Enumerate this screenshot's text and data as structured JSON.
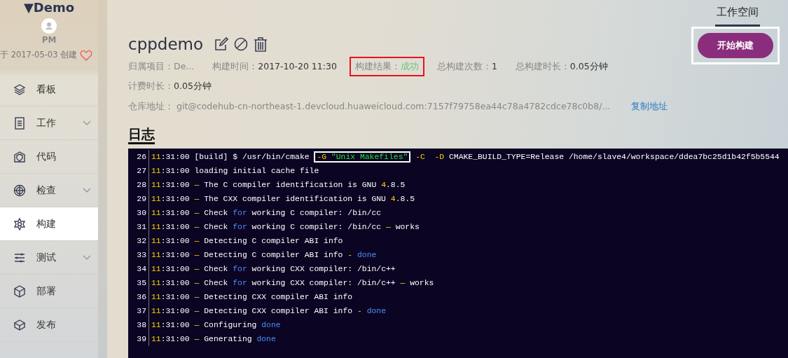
{
  "sidebar": {
    "project": "Demo",
    "collapse_marker": "▼",
    "role": "PM",
    "created": "于 2017-05-03 创建",
    "items": [
      {
        "label": "看板",
        "expandable": false,
        "selected": false
      },
      {
        "label": "工作",
        "expandable": true,
        "selected": false
      },
      {
        "label": "代码",
        "expandable": false,
        "selected": false
      },
      {
        "label": "检查",
        "expandable": true,
        "selected": false
      },
      {
        "label": "构建",
        "expandable": false,
        "selected": true
      },
      {
        "label": "测试",
        "expandable": true,
        "selected": false
      },
      {
        "label": "部署",
        "expandable": false,
        "selected": false
      },
      {
        "label": "发布",
        "expandable": false,
        "selected": false
      }
    ]
  },
  "top_tabs": [
    {
      "label": "工作空间",
      "selected": true
    }
  ],
  "job": {
    "name": "cppdemo",
    "meta_rows": [
      [
        {
          "label": "归属项目：",
          "value": "De...",
          "kind": "muted",
          "highlighted": false
        },
        {
          "label": "构建时间：",
          "value": "2017-10-20 11:30",
          "kind": "plain",
          "highlighted": false
        },
        {
          "label": "构建结果：",
          "value": "成功",
          "kind": "success",
          "highlighted": true
        },
        {
          "label": "总构建次数：",
          "value": "1",
          "kind": "plain",
          "highlighted": false
        },
        {
          "label": "总构建时长：",
          "value": "0.05分钟",
          "kind": "plain",
          "highlighted": false
        }
      ],
      [
        {
          "label": "计费时长：",
          "value": "0.05分钟",
          "kind": "plain",
          "highlighted": false
        }
      ]
    ],
    "repo": {
      "label": "仓库地址：",
      "value": "git@codehub-cn-northeast-1.devcloud.huaweicloud.com:7157f79758ea44c78a4782cdce78c0b8/...",
      "copy_link": "复制地址"
    },
    "start_button": {
      "label": "开始构建",
      "highlighted": true
    }
  },
  "log": {
    "heading": "日志",
    "lines": [
      {
        "number": "26",
        "segments": [
          {
            "text": "11",
            "kind": "hour"
          },
          {
            "text": ":31:00 [build] $ /usr/bin/cmake ",
            "kind": "plain"
          },
          {
            "kind": "group",
            "outlined": true,
            "segments": [
              {
                "text": "-G",
                "kind": "option"
              },
              {
                "text": " \"Unix Makefiles\"",
                "kind": "string"
              }
            ]
          },
          {
            "text": " -C",
            "kind": "option"
          },
          {
            "text": "  -D",
            "kind": "option"
          },
          {
            "text": " CMAKE_BUILD_TYPE=Release /home/slave4/workspace/ddea7bc25d1b42f5b5544",
            "kind": "plain"
          }
        ]
      },
      {
        "number": "27",
        "segments": [
          {
            "text": "11",
            "kind": "hour"
          },
          {
            "text": ":31:00 loading initial cache file",
            "kind": "plain"
          }
        ]
      },
      {
        "number": "28",
        "segments": [
          {
            "text": "11",
            "kind": "hour"
          },
          {
            "text": ":31:00 ",
            "kind": "plain"
          },
          {
            "text": "—",
            "kind": "option"
          },
          {
            "text": " The C compiler identification is GNU ",
            "kind": "plain"
          },
          {
            "text": "4",
            "kind": "number"
          },
          {
            "text": ".8.5",
            "kind": "plain"
          }
        ]
      },
      {
        "number": "29",
        "segments": [
          {
            "text": "11",
            "kind": "hour"
          },
          {
            "text": ":31:00 ",
            "kind": "plain"
          },
          {
            "text": "—",
            "kind": "option"
          },
          {
            "text": " The CXX compiler identification is GNU ",
            "kind": "plain"
          },
          {
            "text": "4",
            "kind": "number"
          },
          {
            "text": ".8.5",
            "kind": "plain"
          }
        ]
      },
      {
        "number": "30",
        "segments": [
          {
            "text": "11",
            "kind": "hour"
          },
          {
            "text": ":31:00 ",
            "kind": "plain"
          },
          {
            "text": "—",
            "kind": "option"
          },
          {
            "text": " Check ",
            "kind": "plain"
          },
          {
            "text": "for",
            "kind": "keyword"
          },
          {
            "text": " working C compiler: /bin/cc",
            "kind": "plain"
          }
        ]
      },
      {
        "number": "31",
        "segments": [
          {
            "text": "11",
            "kind": "hour"
          },
          {
            "text": ":31:00 ",
            "kind": "plain"
          },
          {
            "text": "—",
            "kind": "option"
          },
          {
            "text": " Check ",
            "kind": "plain"
          },
          {
            "text": "for",
            "kind": "keyword"
          },
          {
            "text": " working C compiler: /bin/cc ",
            "kind": "plain"
          },
          {
            "text": "—",
            "kind": "option"
          },
          {
            "text": " works",
            "kind": "plain"
          }
        ]
      },
      {
        "number": "32",
        "segments": [
          {
            "text": "11",
            "kind": "hour"
          },
          {
            "text": ":31:00 ",
            "kind": "plain"
          },
          {
            "text": "—",
            "kind": "option"
          },
          {
            "text": " Detecting C compiler ABI info",
            "kind": "plain"
          }
        ]
      },
      {
        "number": "33",
        "segments": [
          {
            "text": "11",
            "kind": "hour"
          },
          {
            "text": ":31:00 ",
            "kind": "plain"
          },
          {
            "text": "—",
            "kind": "option"
          },
          {
            "text": " Detecting C compiler ABI info ",
            "kind": "plain"
          },
          {
            "text": "-",
            "kind": "option"
          },
          {
            "text": " done",
            "kind": "keyword"
          }
        ]
      },
      {
        "number": "34",
        "segments": [
          {
            "text": "11",
            "kind": "hour"
          },
          {
            "text": ":31:00 ",
            "kind": "plain"
          },
          {
            "text": "—",
            "kind": "option"
          },
          {
            "text": " Check ",
            "kind": "plain"
          },
          {
            "text": "for",
            "kind": "keyword"
          },
          {
            "text": " working CXX compiler: /bin/c++",
            "kind": "plain"
          }
        ]
      },
      {
        "number": "35",
        "segments": [
          {
            "text": "11",
            "kind": "hour"
          },
          {
            "text": ":31:00 ",
            "kind": "plain"
          },
          {
            "text": "—",
            "kind": "option"
          },
          {
            "text": " Check ",
            "kind": "plain"
          },
          {
            "text": "for",
            "kind": "keyword"
          },
          {
            "text": " working CXX compiler: /bin/c++ ",
            "kind": "plain"
          },
          {
            "text": "—",
            "kind": "option"
          },
          {
            "text": " works",
            "kind": "plain"
          }
        ]
      },
      {
        "number": "36",
        "segments": [
          {
            "text": "11",
            "kind": "hour"
          },
          {
            "text": ":31:00 ",
            "kind": "plain"
          },
          {
            "text": "—",
            "kind": "option"
          },
          {
            "text": " Detecting CXX compiler ABI info",
            "kind": "plain"
          }
        ]
      },
      {
        "number": "37",
        "segments": [
          {
            "text": "11",
            "kind": "hour"
          },
          {
            "text": ":31:00 ",
            "kind": "plain"
          },
          {
            "text": "—",
            "kind": "option"
          },
          {
            "text": " Detecting CXX compiler ABI info ",
            "kind": "plain"
          },
          {
            "text": "-",
            "kind": "option"
          },
          {
            "text": " done",
            "kind": "keyword"
          }
        ]
      },
      {
        "number": "38",
        "segments": [
          {
            "text": "11",
            "kind": "hour"
          },
          {
            "text": ":31:00 ",
            "kind": "plain"
          },
          {
            "text": "—",
            "kind": "option"
          },
          {
            "text": " Configuring ",
            "kind": "plain"
          },
          {
            "text": "done",
            "kind": "keyword"
          }
        ]
      },
      {
        "number": "39",
        "segments": [
          {
            "text": "11",
            "kind": "hour"
          },
          {
            "text": ":31:00 ",
            "kind": "plain"
          },
          {
            "text": "—",
            "kind": "option"
          },
          {
            "text": " Generating ",
            "kind": "plain"
          },
          {
            "text": "done",
            "kind": "keyword"
          }
        ]
      }
    ]
  }
}
